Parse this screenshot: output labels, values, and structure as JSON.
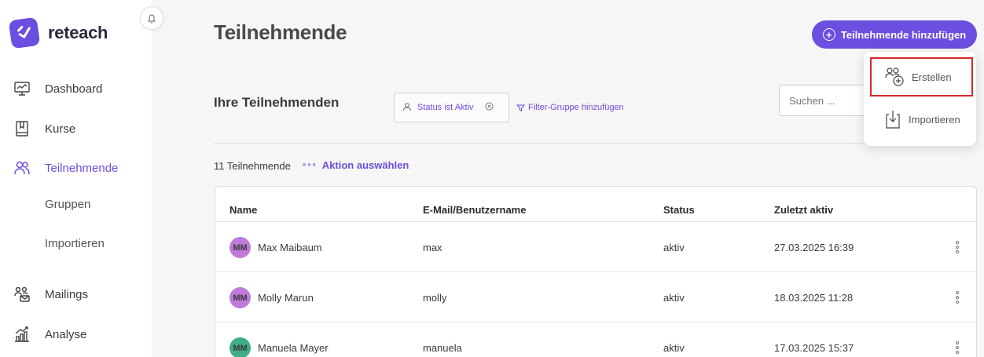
{
  "app": {
    "name": "reteach"
  },
  "sidebar": {
    "items": [
      {
        "label": "Dashboard"
      },
      {
        "label": "Kurse"
      },
      {
        "label": "Teilnehmende"
      },
      {
        "label": "Gruppen"
      },
      {
        "label": "Importieren"
      },
      {
        "label": "Mailings"
      },
      {
        "label": "Analyse"
      }
    ]
  },
  "header": {
    "title": "Teilnehmende",
    "add_button": "Teilnehmende hinzufügen"
  },
  "dropdown": {
    "items": [
      {
        "label": "Erstellen"
      },
      {
        "label": "Importieren"
      }
    ]
  },
  "section": {
    "title": "Ihre Teilnehmenden",
    "filter_chip": "Status ist Aktiv",
    "filter_add": "Filter-Gruppe hinzufügen",
    "search_placeholder": "Suchen ..."
  },
  "list": {
    "count": "11 Teilnehmende",
    "action": "Aktion auswählen"
  },
  "table": {
    "columns": [
      "Name",
      "E-Mail/Benutzername",
      "Status",
      "Zuletzt aktiv"
    ],
    "rows": [
      {
        "initials": "MM",
        "name": "Max Maibaum",
        "email": "max",
        "status": "aktiv",
        "last_active": "27.03.2025 16:39",
        "avatar_color": "#c07ad8"
      },
      {
        "initials": "MM",
        "name": "Molly Marun",
        "email": "molly",
        "status": "aktiv",
        "last_active": "18.03.2025 11:28",
        "avatar_color": "#c07ad8"
      },
      {
        "initials": "MM",
        "name": "Manuela Mayer",
        "email": "manuela",
        "status": "aktiv",
        "last_active": "17.03.2025 15:37",
        "avatar_color": "#3fae86"
      }
    ]
  },
  "colors": {
    "accent": "#6a4fe0",
    "highlight": "#d62828"
  }
}
